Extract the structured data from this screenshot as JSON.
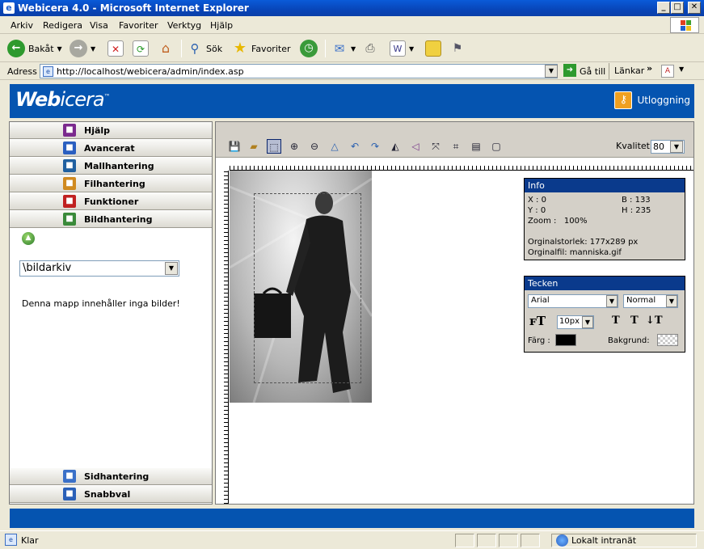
{
  "window": {
    "title": "Webicera 4.0 - Microsoft Internet Explorer"
  },
  "menu": [
    "Arkiv",
    "Redigera",
    "Visa",
    "Favoriter",
    "Verktyg",
    "Hjälp"
  ],
  "toolbar": {
    "back": "Bakåt",
    "search": "Sök",
    "favorites": "Favoriter"
  },
  "address": {
    "label": "Adress",
    "url": "http://localhost/webicera/admin/index.asp",
    "go": "Gå till",
    "links": "Länkar"
  },
  "app": {
    "logo_bold": "Web",
    "logo_rest": "icera",
    "tm": "™",
    "logout": "Utloggning"
  },
  "nav": {
    "top": [
      {
        "label": "Hjälp",
        "color": "#7b2a8e"
      },
      {
        "label": "Avancerat",
        "color": "#2a5fc0"
      },
      {
        "label": "Mallhantering",
        "color": "#2060a0"
      },
      {
        "label": "Filhantering",
        "color": "#d08a20"
      },
      {
        "label": "Funktioner",
        "color": "#c02020"
      },
      {
        "label": "Bildhantering",
        "color": "#3a8a3a"
      }
    ],
    "bottom": [
      {
        "label": "Sidhantering",
        "color": "#3a70c8"
      },
      {
        "label": "Snabbval",
        "color": "#2a60b8"
      }
    ]
  },
  "images": {
    "folder": "\\bildarkiv",
    "empty_message": "Denna mapp innehåller inga bilder!"
  },
  "editor": {
    "quality_label": "Kvalitet:",
    "quality_value": "80"
  },
  "info": {
    "title": "Info",
    "x": "X : 0",
    "y": "Y : 0",
    "b": "B : 133",
    "h": "H : 235",
    "zoom": "Zoom :   100%",
    "orig_size": "Orginalstorlek: 177x289 px",
    "orig_file": "Orginalfil: manniska.gif"
  },
  "tecken": {
    "title": "Tecken",
    "font": "Arial",
    "style": "Normal",
    "size": "10px",
    "color_label": "Färg :",
    "bg_label": "Bakgrund:",
    "text_color": "#000000"
  },
  "status": {
    "text": "Klar",
    "zone": "Lokalt intranät"
  }
}
